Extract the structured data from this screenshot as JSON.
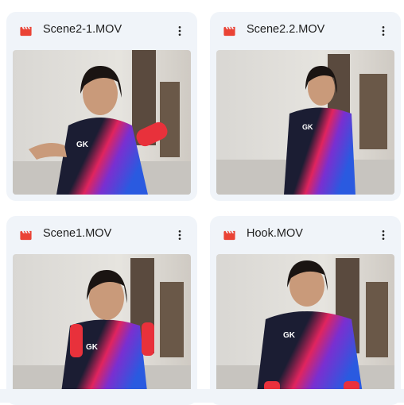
{
  "files": [
    {
      "name": "Scene2-1.MOV",
      "icon": "video-file-icon",
      "menu_icon": "more-vert-icon"
    },
    {
      "name": "Scene2.2.MOV",
      "icon": "video-file-icon",
      "menu_icon": "more-vert-icon"
    },
    {
      "name": "Scene1.MOV",
      "icon": "video-file-icon",
      "menu_icon": "more-vert-icon"
    },
    {
      "name": "Hook.MOV",
      "icon": "video-file-icon",
      "menu_icon": "more-vert-icon"
    }
  ],
  "colors": {
    "card_bg": "#f0f4f9",
    "video_icon": "#ea4335",
    "text": "#1f1f1f",
    "shirt": "#1b1d33",
    "dumbbell": "#e8313b"
  }
}
